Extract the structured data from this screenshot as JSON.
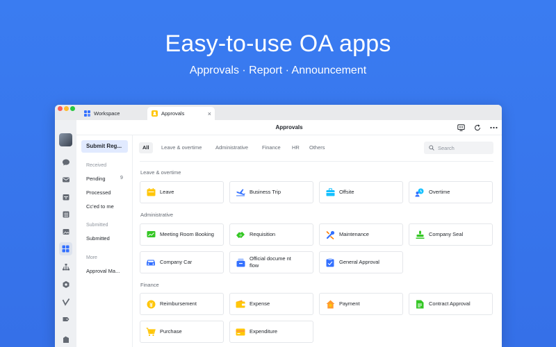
{
  "hero": {
    "title": "Easy-to-use OA apps",
    "subtitle": "Approvals · Report · Announcement"
  },
  "tabs": [
    {
      "label": "Workspace",
      "icon": "grid-icon",
      "active": false
    },
    {
      "label": "Approvals",
      "icon": "approval-icon",
      "active": true,
      "close": "×"
    }
  ],
  "header": {
    "title": "Approvals"
  },
  "left_panel": {
    "submit_label": "Submit Reg...",
    "received_heading": "Received",
    "pending_label": "Pending",
    "pending_count": "9",
    "processed_label": "Processed",
    "cced_label": "Cc'ed to me",
    "submitted_heading": "Submitted",
    "submitted_label": "Submitted",
    "more_heading": "More",
    "manage_label": "Approval Ma..."
  },
  "filters": [
    "All",
    "Leave & overtime",
    "Administrative",
    "Finance",
    "HR",
    "Others"
  ],
  "search": {
    "placeholder": "Search"
  },
  "sections": {
    "leave": "Leave & overtime",
    "admin": "Administrative",
    "finance": "Finance"
  },
  "cards": {
    "leave": "Leave",
    "business_trip": "Business Trip",
    "offsite": "Offsite",
    "overtime": "Overtime",
    "meeting_room": "Meeting Room Booking",
    "requisition": "Requisition",
    "maintenance": "Maintenance",
    "company_seal": "Company Seal",
    "company_car": "Company Car",
    "official_doc": "Official docume nt flow",
    "general_approval": "General Approval",
    "reimbursement": "Reimbursement",
    "expense": "Expense",
    "payment": "Payment",
    "contract_approval": "Contract Approval",
    "purchase": "Purchase",
    "expenditure": "Expenditure"
  },
  "colors": {
    "background": "#3a7cf1",
    "accent_blue": "#3370ff",
    "icon_yellow": "#ffc60a",
    "icon_green": "#34c724",
    "icon_teal": "#14c0ff"
  }
}
